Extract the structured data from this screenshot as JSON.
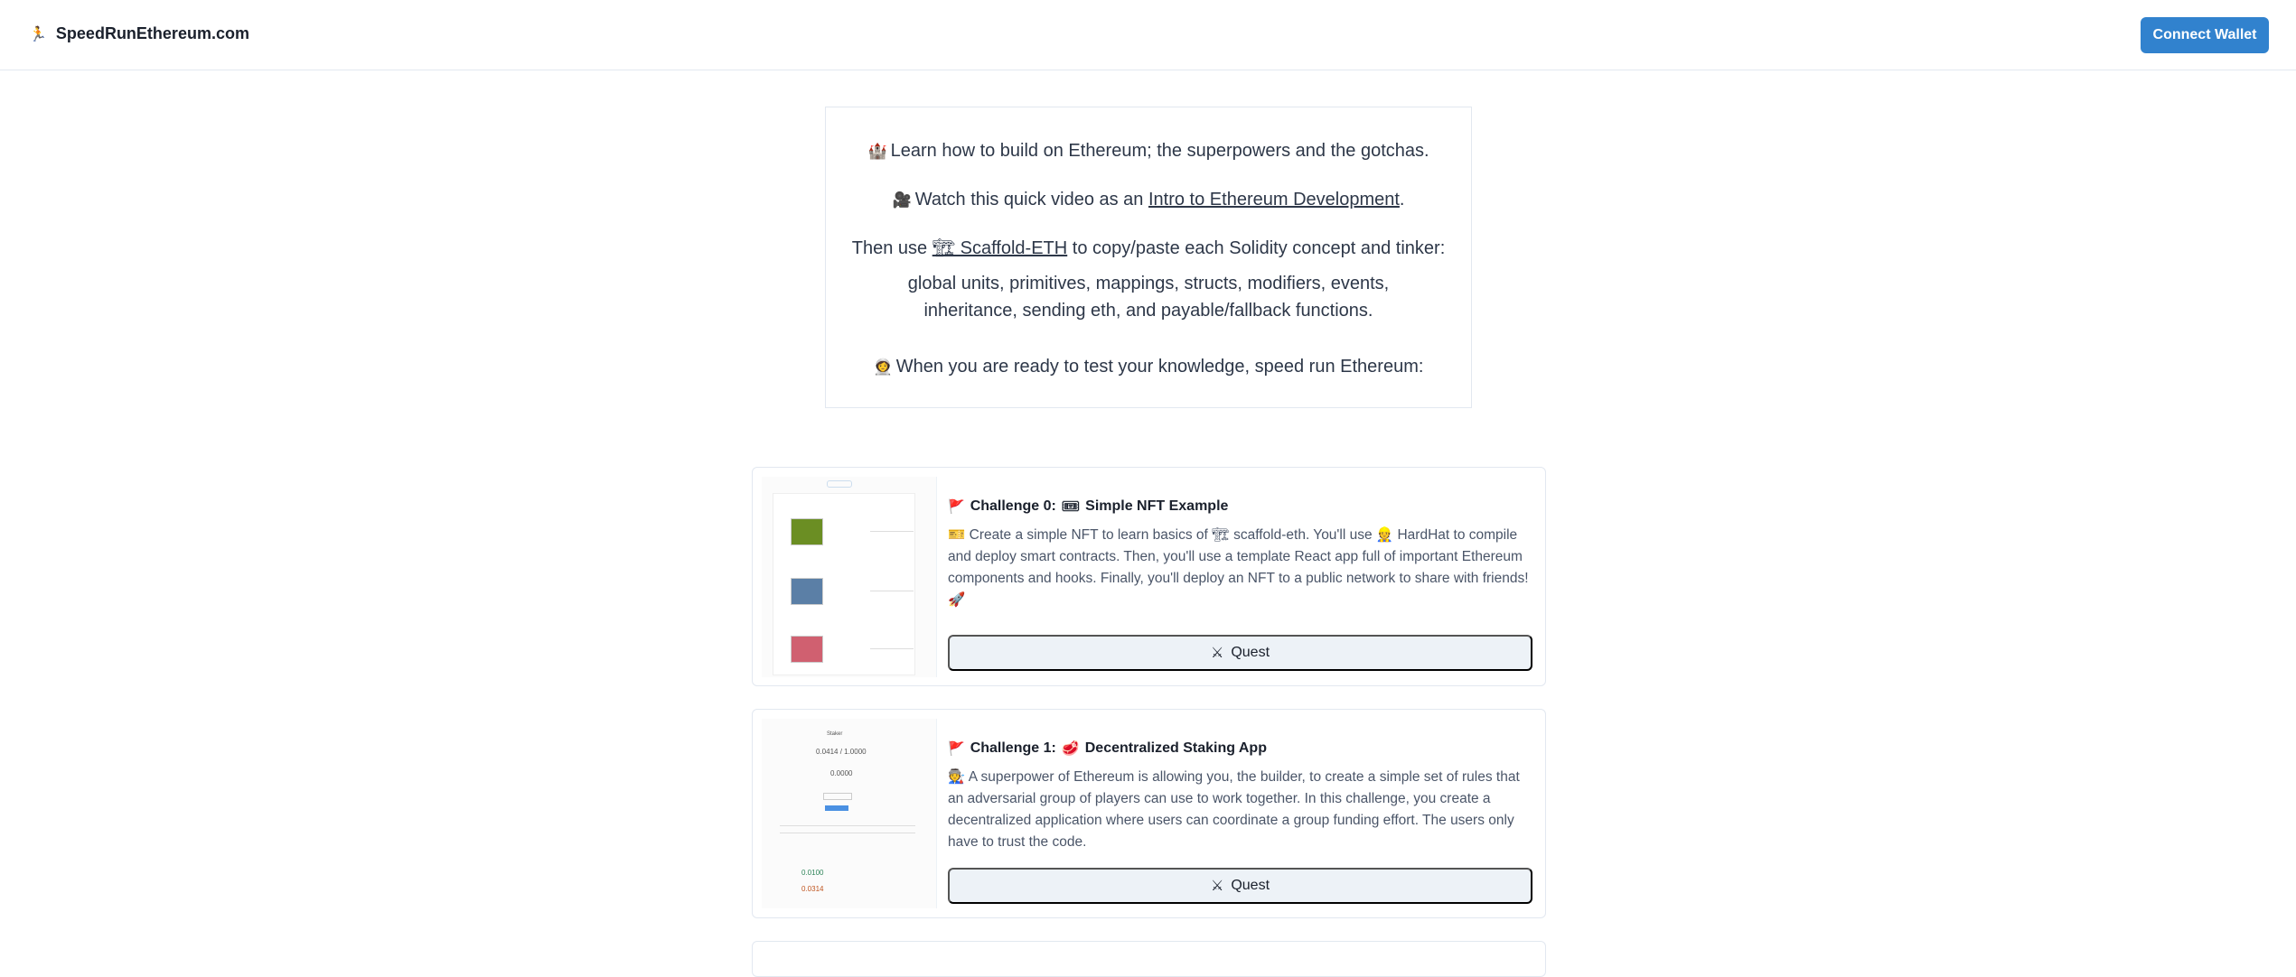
{
  "header": {
    "logo_text": "SpeedRunEthereum.com",
    "connect_label": "Connect Wallet"
  },
  "intro": {
    "line1": "Learn how to build on Ethereum; the superpowers and the gotchas.",
    "line2_prefix": "Watch this quick video as an ",
    "line2_link": "Intro to Ethereum Development",
    "line2_suffix": ".",
    "line3_prefix": "Then use ",
    "line3_link": "🏗 Scaffold-ETH",
    "line3_suffix": " to copy/paste each Solidity concept and tinker:",
    "line4": "global units, primitives, mappings, structs, modifiers, events, inheritance, sending eth, and payable/fallback functions.",
    "line5": "When you are ready to test your knowledge, speed run Ethereum:"
  },
  "challenges": [
    {
      "title_prefix": "Challenge 0:",
      "title": "Simple NFT Example",
      "description": "Create a simple NFT to learn basics of 🏗 scaffold-eth. You'll use 👷 HardHat to compile and deploy smart contracts. Then, you'll use a template React app full of important Ethereum components and hooks. Finally, you'll deploy an NFT to a public network to share with friends! 🚀",
      "quest_label": "Quest"
    },
    {
      "title_prefix": "Challenge 1:",
      "title": "Decentralized Staking App",
      "description": "A superpower of Ethereum is allowing you, the builder, to create a simple set of rules that an adversarial group of players can use to work together. In this challenge, you create a decentralized application where users can coordinate a group funding effort. The users only have to trust the code.",
      "quest_label": "Quest",
      "thumb_stats": [
        "0.0414 / 1.0000",
        "0.0000",
        "0.0100",
        "0.0314"
      ]
    }
  ],
  "icons": {
    "logo": "runner-icon",
    "flag": "flag-icon",
    "quest": "crossed-swords-icon"
  },
  "colors": {
    "accent": "#3182ce",
    "quest_bg": "#edf2f7"
  }
}
